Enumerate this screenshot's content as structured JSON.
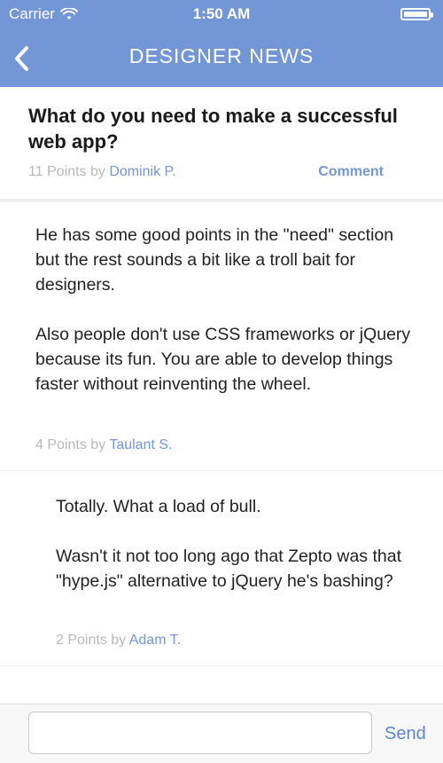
{
  "status_bar": {
    "carrier": "Carrier",
    "time": "1:50 AM"
  },
  "nav": {
    "title": "DESIGNER NEWS"
  },
  "story": {
    "title": "What do you need to make a successful web app?",
    "points": "11 Points by ",
    "author": "Dominik P.",
    "comment_label": "Comment"
  },
  "comments": [
    {
      "text": "He has some good points in the \"need\" section but the rest sounds a bit like a troll bait for designers.\n\nAlso people don't use CSS frameworks or jQuery because its fun. You are able to develop things faster without reinventing the wheel.",
      "points": "4 Points by ",
      "author": "Taulant S."
    },
    {
      "text": "Totally. What a load of bull.\n\nWasn't it not too long ago that Zepto was that \"hype.js\" alternative to jQuery he's bashing?",
      "points": "2 Points by ",
      "author": "Adam T."
    }
  ],
  "reply": {
    "value": "",
    "placeholder": "",
    "send_label": "Send"
  },
  "colors": {
    "accent": "#7396d6",
    "meta_text": "#b8b8b8",
    "body_text": "#222222"
  }
}
